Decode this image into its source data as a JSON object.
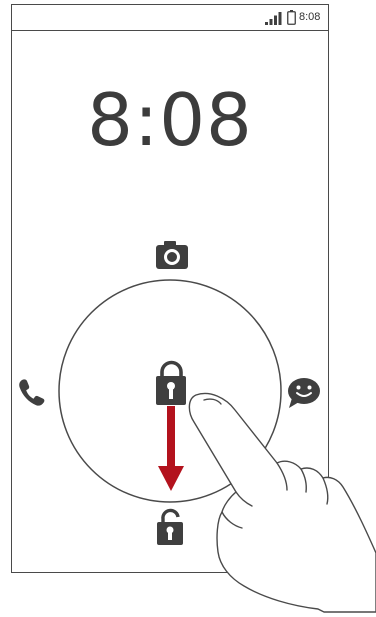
{
  "status_bar": {
    "time": "8:08",
    "icons": [
      "signal-icon",
      "battery-icon"
    ]
  },
  "lock_screen": {
    "clock": "8:08",
    "ring_shortcuts": {
      "top": "camera-icon",
      "left": "phone-icon",
      "right": "message-icon",
      "bottom": "unlock-icon"
    },
    "center": "lock-icon",
    "gesture": "drag-down-arrow",
    "colors": {
      "arrow": "#b3121d",
      "icon": "#3f3f3f",
      "outline": "#4a4a4a"
    }
  }
}
